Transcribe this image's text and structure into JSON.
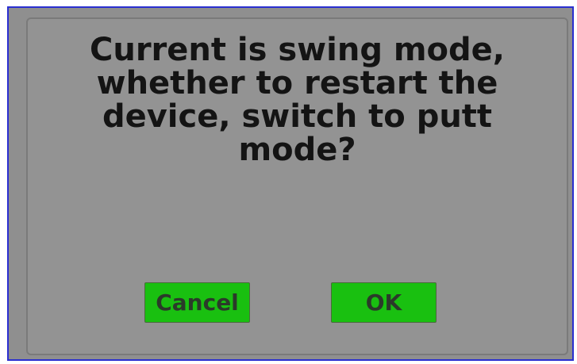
{
  "dialog": {
    "message_lines": [
      "Current is swing mode,",
      "whether to restart the",
      "device, switch to putt",
      "mode?"
    ],
    "cancel_label": "Cancel",
    "ok_label": "OK"
  },
  "colors": {
    "screen_border": "#2a2fd0",
    "background": "#8f8f8f",
    "button_green": "#19c010",
    "text": "#141414"
  }
}
